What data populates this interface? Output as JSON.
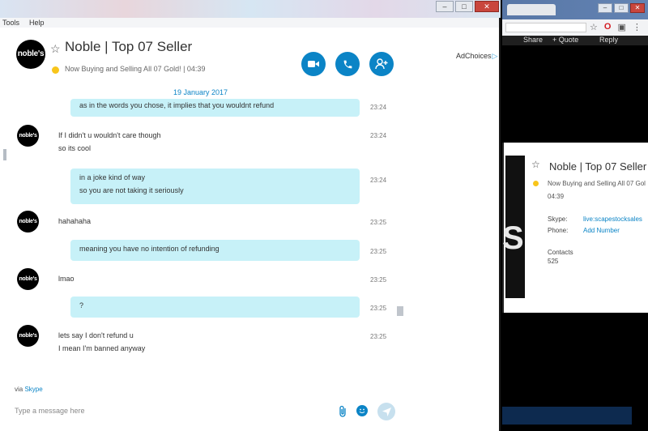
{
  "menu": {
    "tools": "Tools",
    "help": "Help"
  },
  "window_controls": {
    "minimize": "–",
    "maximize": "□",
    "close": "✕"
  },
  "contact": {
    "avatar_text_top": "noble's",
    "name": "Noble | Top 07 Seller",
    "status": "Now Buying and Selling All 07 Gold!  |  04:39"
  },
  "ads": {
    "label": "AdChoices"
  },
  "conversation": {
    "date": "19 January 2017",
    "messages": [
      {
        "kind": "out",
        "lines": [
          "as in the words you chose, it implies that you wouldnt refund"
        ],
        "time": "23:24"
      },
      {
        "kind": "in",
        "lines": [
          "If I didn't u wouldn't care though",
          "so its cool"
        ],
        "time": "23:24"
      },
      {
        "kind": "out",
        "lines": [
          "in a joke kind of way",
          "so you are not taking it seriously"
        ],
        "time": "23:24"
      },
      {
        "kind": "in",
        "lines": [
          "hahahaha"
        ],
        "time": "23:25"
      },
      {
        "kind": "out",
        "lines": [
          "meaning you have no intention of refunding"
        ],
        "time": "23:25"
      },
      {
        "kind": "in",
        "lines": [
          "lmao"
        ],
        "time": "23:25"
      },
      {
        "kind": "out",
        "lines": [
          "?"
        ],
        "time": "23:25"
      },
      {
        "kind": "in",
        "lines": [
          "lets say I don't refund u",
          "I mean I'm banned anyway"
        ],
        "time": "23:25"
      }
    ]
  },
  "footer": {
    "via_prefix": "via",
    "via_link": "Skype",
    "composer_placeholder": "Type a message here"
  },
  "browser": {
    "page_buttons": [
      "Share",
      "+ Quote",
      "Reply"
    ],
    "card": {
      "name": "Noble | Top 07 Seller",
      "status": "Now Buying and Selling All 07 Gol",
      "time": "04:39",
      "skype_label": "Skype:",
      "skype_value": "live:scapestocksales",
      "phone_label": "Phone:",
      "phone_value": "Add Number",
      "contacts_label": "Contacts",
      "contacts_value": "525",
      "image_glyph": "S"
    }
  },
  "colors": {
    "accent": "#0b84c6",
    "bubble": "#c7f1f8",
    "status": "#f8c51b"
  }
}
